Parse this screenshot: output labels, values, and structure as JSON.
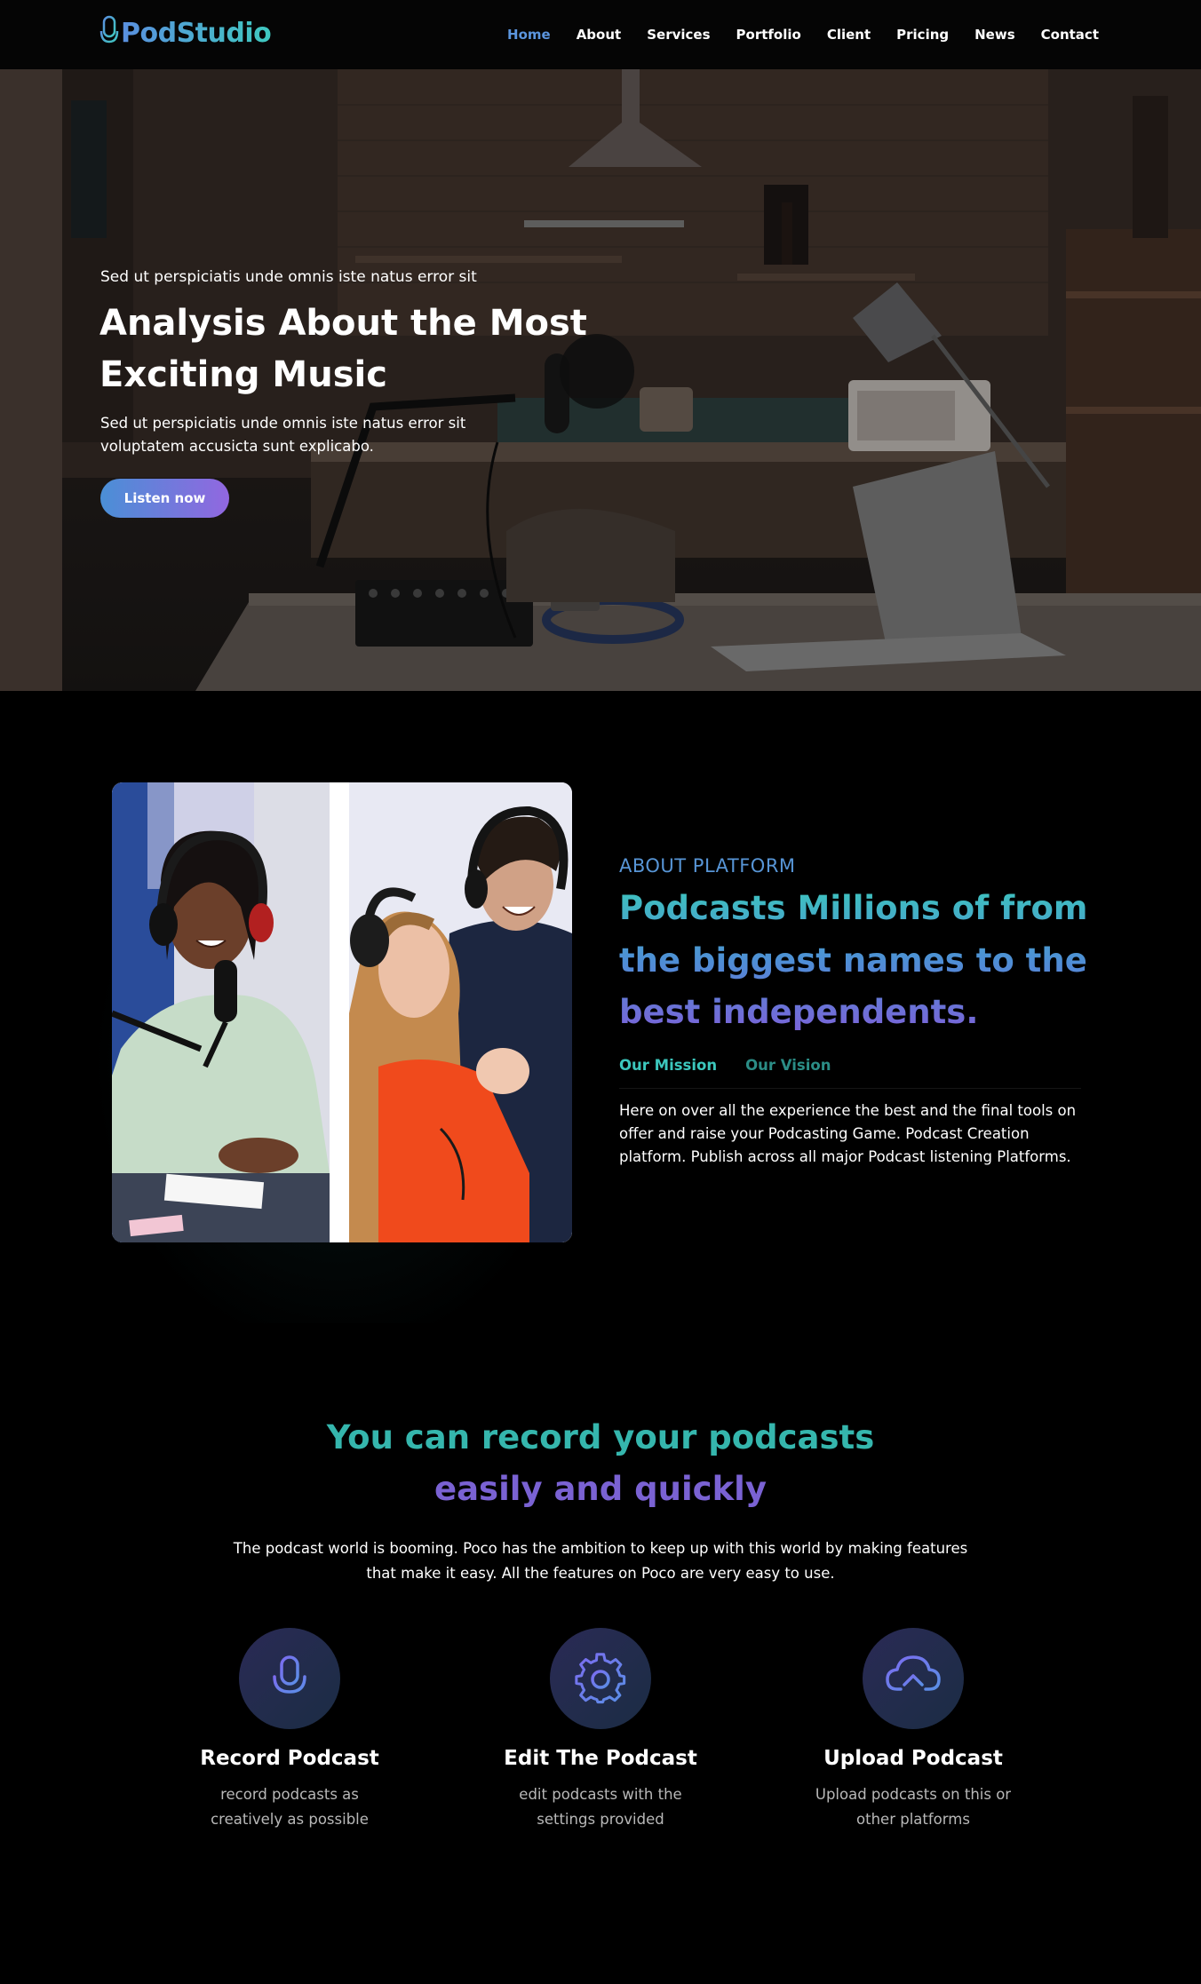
{
  "brand": {
    "name": "PodStudio",
    "icon": "microphone-icon",
    "colors": [
      "#5a8fe0",
      "#3fc9c0"
    ]
  },
  "nav": {
    "items": [
      {
        "label": "Home",
        "active": true
      },
      {
        "label": "About",
        "active": false
      },
      {
        "label": "Services",
        "active": false
      },
      {
        "label": "Portfolio",
        "active": false
      },
      {
        "label": "Client",
        "active": false
      },
      {
        "label": "Pricing",
        "active": false
      },
      {
        "label": "News",
        "active": false
      },
      {
        "label": "Contact",
        "active": false
      }
    ],
    "active_color": "#5b95de"
  },
  "hero": {
    "kicker": "Sed ut perspiciatis unde omnis iste natus error sit",
    "title": "Analysis About the Most Exciting Music",
    "description": "Sed ut perspiciatis unde omnis iste natus error sit voluptatem accusicta sunt explicabo.",
    "cta_label": "Listen now",
    "cta_gradient": [
      "#4a8fd6",
      "#9267e0"
    ]
  },
  "about": {
    "kicker": "ABOUT PLATFORM",
    "title": "Podcasts Millions of from the biggest names to the best independents.",
    "tabs": [
      {
        "label": "Our Mission",
        "active": true
      },
      {
        "label": "Our Vision",
        "active": false
      }
    ],
    "text": "Here on over all the experience the best  and the final tools on offer and raise your Podcasting Game. Podcast Creation platform. Publish across all major Podcast listening Platforms."
  },
  "features": {
    "title_line1": "You can record  your podcasts",
    "title_line2": "easily and quickly",
    "description": "The podcast world is booming. Poco has the ambition to keep up with this world by making features that make it easy. All the features on Poco are very easy to use.",
    "items": [
      {
        "icon": "microphone-icon",
        "title": "Record Podcast",
        "description": "record podcasts as creatively as possible"
      },
      {
        "icon": "gear-icon",
        "title": "Edit The Podcast",
        "description": "edit podcasts with the settings provided"
      },
      {
        "icon": "cloud-upload-icon",
        "title": "Upload Podcast",
        "description": "Upload podcasts on this or other platforms"
      }
    ],
    "icon_color": "#6f7ff0"
  }
}
